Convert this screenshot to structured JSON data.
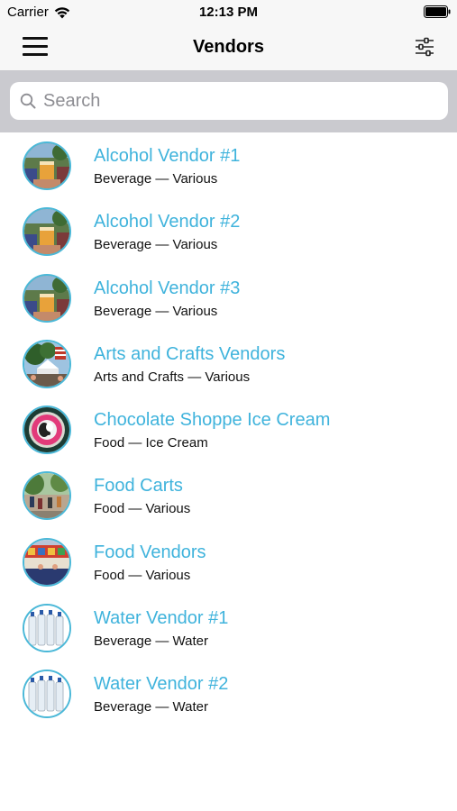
{
  "status_bar": {
    "carrier": "Carrier",
    "time": "12:13 PM",
    "wifi_icon": "wifi-icon",
    "battery_icon": "battery-icon"
  },
  "nav_bar": {
    "title": "Vendors",
    "menu_icon": "hamburger-menu-icon",
    "filter_icon": "sliders-filter-icon"
  },
  "search": {
    "placeholder": "Search",
    "value": ""
  },
  "colors": {
    "accent": "#3fb3dc",
    "avatar_border": "#4ab8d8",
    "search_background": "#cacacf",
    "nav_background": "#f7f7f7"
  },
  "vendors": [
    {
      "name": "Alcohol Vendor #1",
      "subtitle": "Beverage — Various",
      "image": "beer-cup-photo"
    },
    {
      "name": "Alcohol Vendor #2",
      "subtitle": "Beverage — Various",
      "image": "beer-cup-photo"
    },
    {
      "name": "Alcohol Vendor #3",
      "subtitle": "Beverage — Various",
      "image": "beer-cup-photo"
    },
    {
      "name": "Arts and Crafts Vendors",
      "subtitle": "Arts and Crafts — Various",
      "image": "craft-tents-photo"
    },
    {
      "name": "Chocolate Shoppe Ice Cream",
      "subtitle": "Food — Ice Cream",
      "image": "ice-cream-logo"
    },
    {
      "name": "Food Carts",
      "subtitle": "Food — Various",
      "image": "street-crowd-photo"
    },
    {
      "name": "Food Vendors",
      "subtitle": "Food — Various",
      "image": "food-stand-photo"
    },
    {
      "name": "Water Vendor #1",
      "subtitle": "Beverage — Water",
      "image": "water-bottles-photo"
    },
    {
      "name": "Water Vendor #2",
      "subtitle": "Beverage — Water",
      "image": "water-bottles-photo"
    }
  ]
}
